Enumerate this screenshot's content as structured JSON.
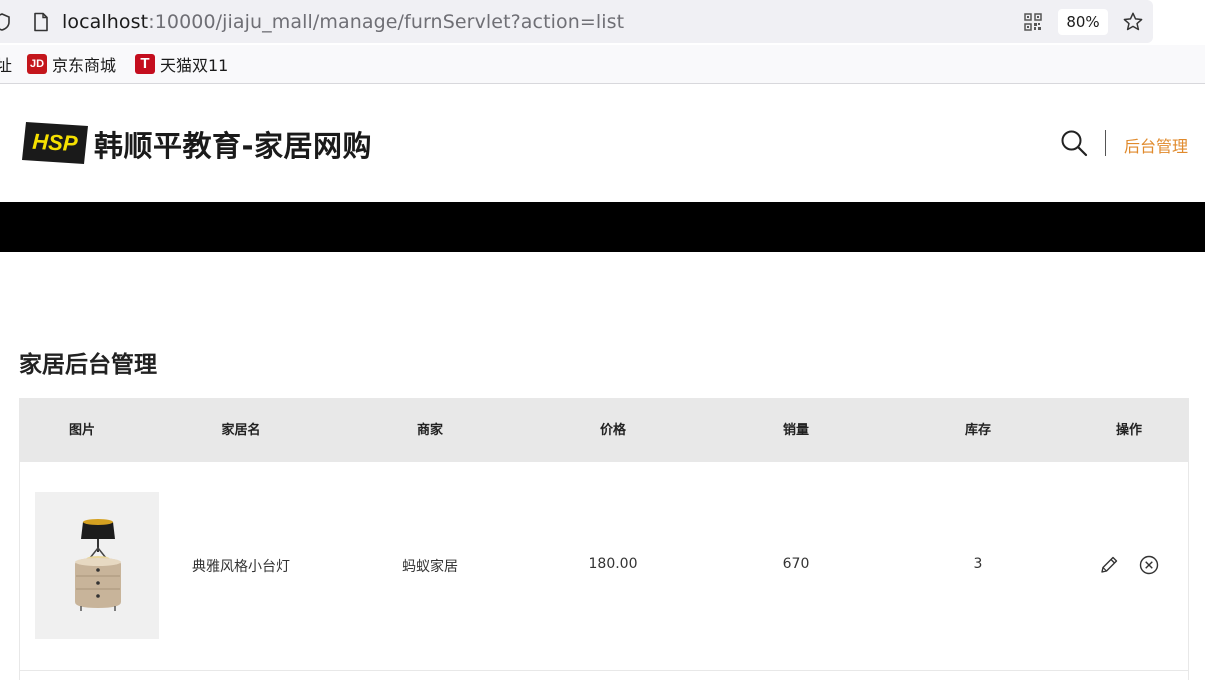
{
  "browser": {
    "url_host": "localhost",
    "url_path": ":10000/jiaju_mall/manage/furnServlet?action=list",
    "zoom": "80%",
    "bookmarks": [
      {
        "label": "址",
        "icon": "none"
      },
      {
        "label": "京东商城",
        "icon_text": "JD"
      },
      {
        "label": "天猫双11",
        "icon_text": "T"
      }
    ]
  },
  "header": {
    "logo_text": "HSP",
    "title": "韩顺平教育-家居网购",
    "admin_link": "后台管理"
  },
  "page": {
    "section_title": "家居后台管理"
  },
  "table": {
    "columns": [
      "图片",
      "家居名",
      "商家",
      "价格",
      "销量",
      "库存",
      "操作"
    ],
    "rows": [
      {
        "name": "典雅风格小台灯",
        "maker": "蚂蚁家居",
        "price": "180.00",
        "sales": "670",
        "stock": "3"
      }
    ]
  },
  "colors": {
    "accent": "#e08a2c",
    "logo_yellow": "#f5e000",
    "header_band": "#000000",
    "table_header_bg": "#e8e8e8"
  }
}
